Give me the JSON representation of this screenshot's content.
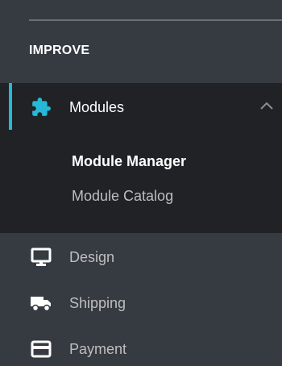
{
  "sidebar": {
    "section_heading": "IMPROVE",
    "modules": {
      "label": "Modules",
      "icon": "puzzle-icon",
      "expanded": true,
      "submenu": [
        {
          "label": "Module Manager",
          "current": true
        },
        {
          "label": "Module Catalog",
          "current": false
        }
      ]
    },
    "items": [
      {
        "label": "Design",
        "icon": "monitor-icon"
      },
      {
        "label": "Shipping",
        "icon": "truck-icon"
      },
      {
        "label": "Payment",
        "icon": "credit-card-icon"
      }
    ]
  },
  "colors": {
    "background": "#363a41",
    "active_background": "#202226",
    "accent": "#25b9d7",
    "text_active": "#ffffff",
    "text_muted": "#bebebe"
  }
}
